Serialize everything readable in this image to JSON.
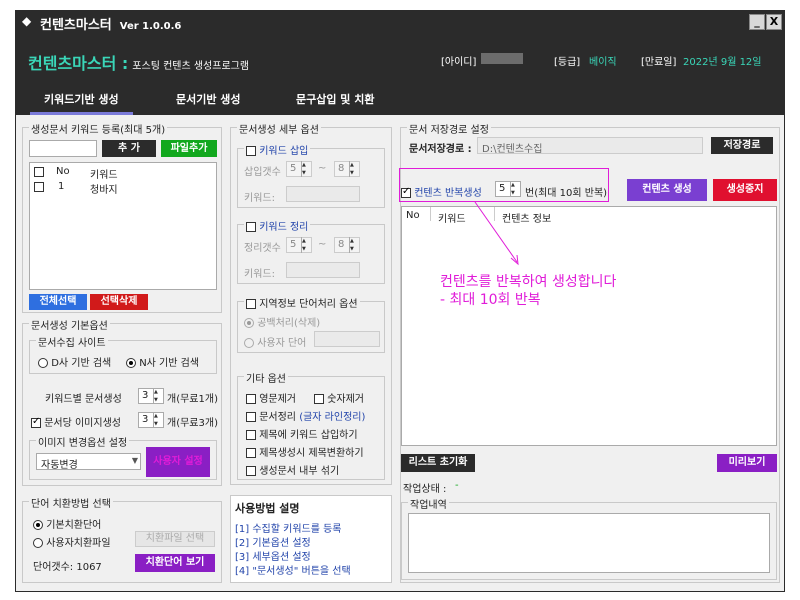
{
  "window": {
    "title": "컨텐츠마스터",
    "version": "Ver 1.0.0.6",
    "minimize": "_",
    "close": "X"
  },
  "header": {
    "brand": "컨텐츠마스터 :",
    "subtitle": "포스팅 컨텐츠 생성프로그램",
    "id_label": "[아이디]",
    "grade_label": "[등급]",
    "grade_value": "베이직",
    "expiry_label": "[만료일]",
    "expiry_value": "2022년 9월 12일"
  },
  "tabs": [
    "키워드기반 생성",
    "문서기반 생성",
    "문구삽입 및 치환"
  ],
  "keyword_reg": {
    "title": "생성문서 키워드 등록(최대 5개)",
    "input_value": "",
    "add_btn": "추 가",
    "file_add_btn": "파일추가",
    "col_no": "No",
    "col_keyword": "키워드",
    "rows": [
      {
        "no": "1",
        "keyword": "청바지"
      }
    ],
    "select_all_btn": "전체선택",
    "delete_sel_btn": "선택삭제"
  },
  "basic_opts": {
    "title": "문서생성 기본옵션",
    "site_title": "문서수집 사이트",
    "radio_d": "D사 기반 검색",
    "radio_n": "N사 기반 검색",
    "per_kw_label": "키워드별 문서생성",
    "per_kw_value": "3",
    "per_kw_unit": "개(무료1개)",
    "img_gen_label": "문서당 이미지생성",
    "img_gen_value": "3",
    "img_gen_unit": "개(무료3개)",
    "img_opt_title": "이미지 변경옵션 설정",
    "img_select": "자동변경",
    "user_setting_btn": "사용자 설정"
  },
  "replace": {
    "title": "단어 치환방법 선택",
    "radio_basic": "기본치환단어",
    "radio_user": "사용자치환파일",
    "file_select_btn": "치환파일 선택",
    "count_label": "단어갯수: 1067",
    "view_btn": "치환단어 보기"
  },
  "detail": {
    "title": "문서생성 세부 옵션",
    "kw_insert": "키워드 삽입",
    "insert_count_label": "삽입갯수",
    "insert_min": "5",
    "insert_max": "8",
    "tilde": "~",
    "keyword_label": "키워드:",
    "kw_sort": "키워드 정리",
    "sort_count_label": "정리갯수",
    "sort_min": "5",
    "sort_max": "8",
    "keyword_label2": "키워드:",
    "region_title": "지역정보 단어처리 옵션",
    "radio_blank": "공백처리(삭제)",
    "radio_user_word": "사용자 단어",
    "etc_title": "기타 옵션",
    "remove_eng": "영문제거",
    "remove_num": "숫자제거",
    "doc_sort": "문서정리",
    "doc_sort_note": "(글자 라인정리)",
    "title_insert_kw": "제목에 키워드 삽입하기",
    "title_replace": "제목생성시 제목변환하기",
    "shuffle": "생성문서 내부 섞기"
  },
  "usage": {
    "title": "사용방법 설명",
    "steps": [
      "[1] 수집할 키워드를 등록",
      "[2] 기본옵션 설정",
      "[3] 세부옵션 설정",
      "[4] \"문서생성\" 버튼을 선택"
    ]
  },
  "save_path": {
    "title": "문서 저장경로 설정",
    "label": "문서저장경로 :",
    "value": "D:\\컨텐츠수집",
    "btn": "저장경로"
  },
  "repeat": {
    "label": "컨텐츠 반복생성",
    "value": "5",
    "unit": "번(최대 10회 반복)",
    "generate_btn": "컨텐츠 생성",
    "stop_btn": "생성중지"
  },
  "result_table": {
    "col_no": "No",
    "col_keyword": "키워드",
    "col_info": "컨텐츠 정보"
  },
  "annotation": {
    "line1": "컨텐츠를 반복하여 생성합니다",
    "line2": "- 최대 10회 반복"
  },
  "list_reset_btn": "리스트 초기화",
  "preview_btn": "미리보기",
  "status_label": "작업상태 :",
  "status_value": "-",
  "log_title": "작업내역",
  "colors": {
    "accent_purple": "#7a3fd1",
    "stop_red": "#e0102f",
    "green": "#12a81e",
    "magenta": "#e01cd8",
    "blue": "#2e6fe0"
  }
}
